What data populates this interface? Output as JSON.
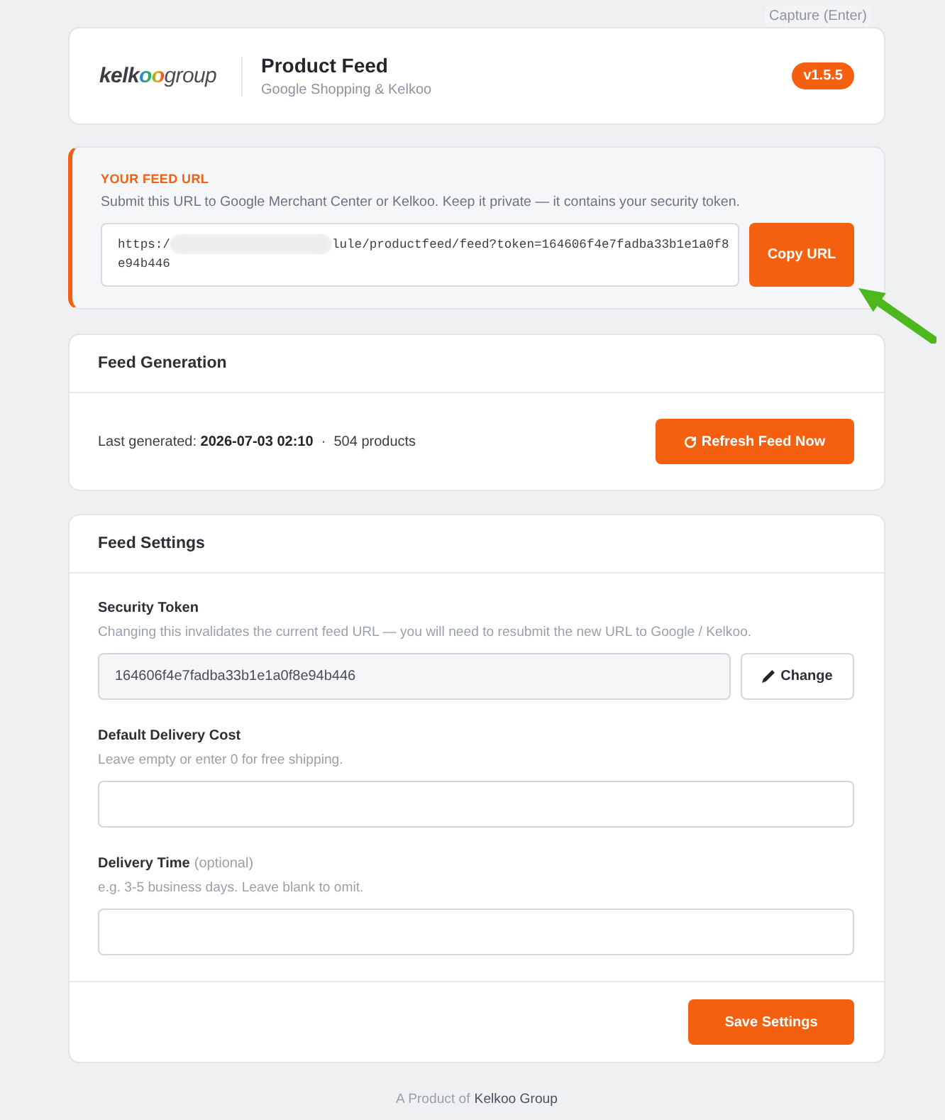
{
  "capture_hint": {
    "text": "Capture (Enter)"
  },
  "header": {
    "logo": {
      "lead": "kelk",
      "accent": "oo",
      "tail": "group"
    },
    "title": "Product Feed",
    "subtitle": "Google Shopping & Kelkoo",
    "version": "v1.5.5"
  },
  "feed_url": {
    "label": "YOUR FEED URL",
    "description": "Submit this URL to Google Merchant Center or Kelkoo. Keep it private — it contains your security token.",
    "value_before_blur": "https:/",
    "value_after_blur": "lule/productfeed/feed?token=164606f4e7fadba33b1e1a0f8e94b446",
    "button": "Copy URL"
  },
  "feed_generation": {
    "title": "Feed Generation",
    "status": "Last generated: **2026-07-03 02:10**  ·  504 products",
    "button": "Refresh Feed Now"
  },
  "feed_settings": {
    "title": "Feed Settings",
    "fields": [
      {
        "kind": "token",
        "label": "Security Token",
        "help": "Changing this invalidates the current feed URL — you will need to resubmit the new URL to Google / Kelkoo.",
        "value": "164606f4e7fadba33b1e1a0f8e94b446",
        "button": "Change"
      },
      {
        "kind": "text",
        "label": "Default Delivery Cost",
        "help": "Leave empty or enter 0 for free shipping."
      },
      {
        "kind": "text",
        "label": "Delivery Time",
        "note": "(optional)",
        "help": "e.g. 3-5 business days. Leave blank to omit."
      }
    ],
    "button": "Save Settings"
  },
  "footer": {
    "text": "A Product of",
    "link": "Kelkoo Group"
  }
}
